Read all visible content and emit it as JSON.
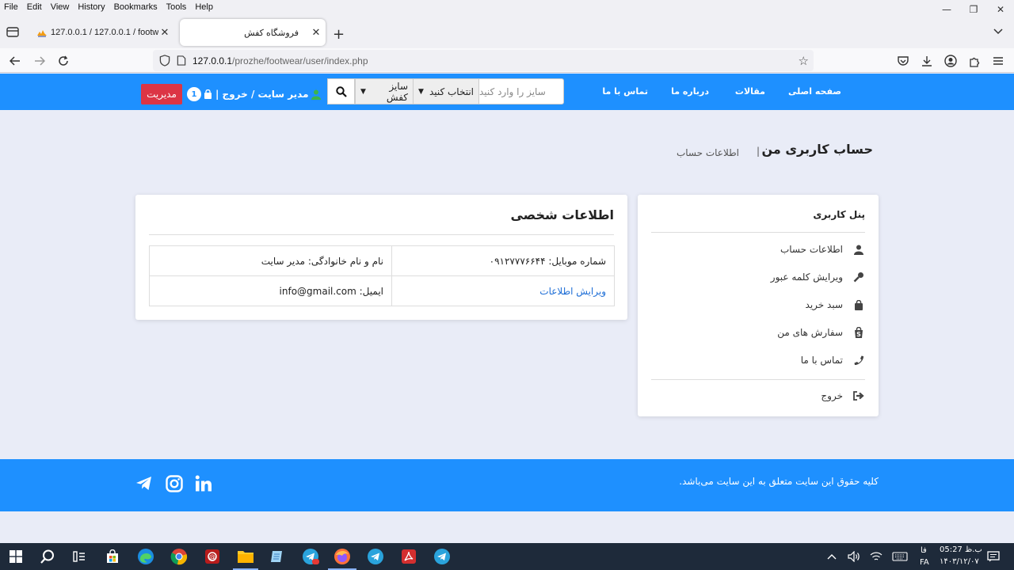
{
  "menubar": {
    "items": [
      "File",
      "Edit",
      "View",
      "History",
      "Bookmarks",
      "Tools",
      "Help"
    ]
  },
  "tabs": {
    "inactive_title": "127.0.0.1 / 127.0.0.1 / footwear",
    "active_title": "فروشگاه کفش"
  },
  "url": {
    "host": "127.0.0.1",
    "path": "/prozhe/footwear/user/index.php"
  },
  "header": {
    "nav": [
      "صفحه اصلی",
      "مقالات",
      "درباره ما",
      "تماس با ما"
    ],
    "search_placeholder": "سایز را وارد کنید",
    "select_choose": "انتخاب کنید",
    "select_size": "سایز کفش",
    "user_text": "مدیر سایت / خروج |",
    "cart_count": "1",
    "admin_label": "مدیریت"
  },
  "page": {
    "title": "حساب کاربری من",
    "breadcrumb_sep": "|",
    "breadcrumb": "اطلاعات حساب"
  },
  "personal": {
    "title": "اطلاعات شخصی",
    "name": "نام و نام خانوادگی: مدیر سایت",
    "mobile": "شماره موبایل: ۰۹۱۲۷۷۷۶۶۴۴",
    "email": "ایمیل: info@gmail.com",
    "edit_link": "ویرایش اطلاعات"
  },
  "panel": {
    "title": "پنل کاربری",
    "items": [
      {
        "label": "اطلاعات حساب",
        "icon": "user-icon"
      },
      {
        "label": "ویرایش کلمه عبور",
        "icon": "key-icon"
      },
      {
        "label": "سبد خرید",
        "icon": "bag-icon"
      },
      {
        "label": "سفارش های من",
        "icon": "shopify-bag-icon"
      },
      {
        "label": "تماس با ما",
        "icon": "phone-icon"
      }
    ],
    "logout": "خروج"
  },
  "footer": {
    "copyright": "کلیه حقوق این سایت متعلق به این سایت می‌باشد."
  },
  "taskbar": {
    "lang": "FA",
    "time": "05:27 ب.ظ",
    "date": "۱۴۰۳/۱۲/۰۷",
    "lang_top": "فا"
  },
  "colors": {
    "brand": "#1e90ff",
    "danger": "#dc3545",
    "page_bg": "#e9ecf7"
  }
}
